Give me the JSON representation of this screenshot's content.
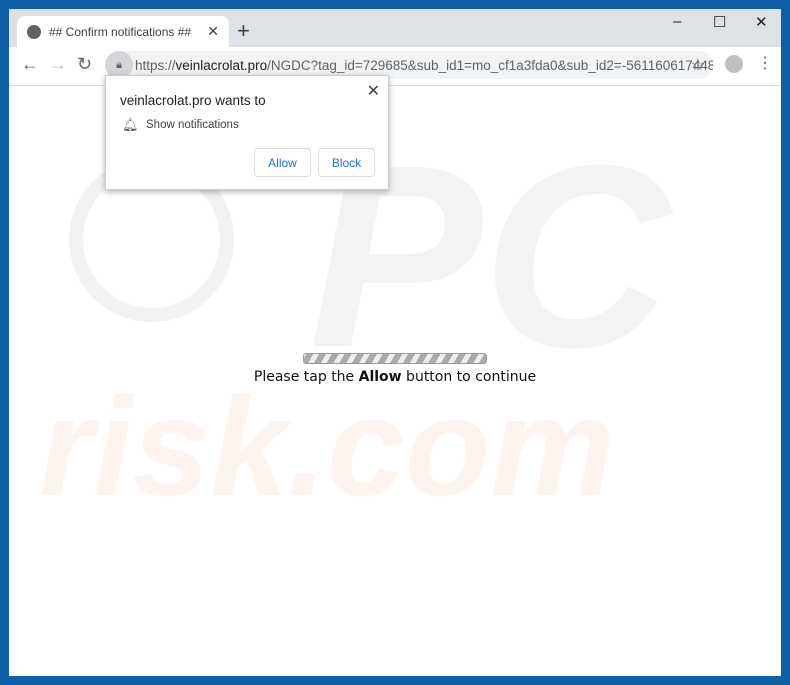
{
  "tab": {
    "title": "## Confirm notifications ##",
    "icon": "globe-icon"
  },
  "window_controls": {
    "minimize": "–",
    "maximize": "☐",
    "close": "✕"
  },
  "address_bar": {
    "url_prefix": "https://",
    "url_domain": "veinlacrolat.pro",
    "url_path": "/NGDC?tag_id=729685&sub_id1=mo_cf1a3fda0&sub_id2=-561160617448..."
  },
  "popup": {
    "title": "veinlacrolat.pro wants to",
    "permission": "Show notifications",
    "allow": "Allow",
    "block": "Block"
  },
  "page": {
    "progress_percent": 100,
    "message_before": "Please tap the ",
    "message_bold": "Allow",
    "message_after": " button to continue"
  },
  "watermark": {
    "text_top": "PC",
    "text_bottom": "risk.com"
  }
}
